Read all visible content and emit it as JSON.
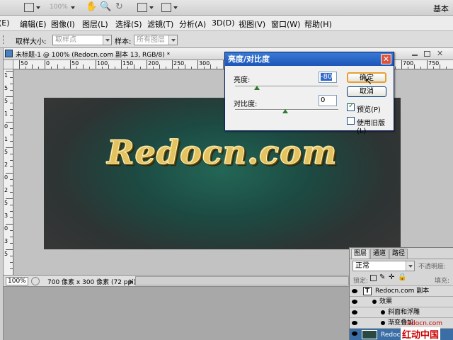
{
  "appbar": {
    "zoom": "100%",
    "workspace": "基本"
  },
  "menu": {
    "items": [
      "编辑(E)",
      "图像(I)",
      "图层(L)",
      "选择(S)",
      "滤镜(T)",
      "分析(A)",
      "3D(D)",
      "视图(V)",
      "窗口(W)",
      "帮助(H)"
    ],
    "left_fragment": "(E)"
  },
  "options": {
    "sample_size_label": "取样大小:",
    "sample_size_value": "取样点",
    "sample_label": "样本:",
    "sample_value": "所有图层"
  },
  "document": {
    "tab_title": "未标题-1 @ 100% (Redocn.com 副本 13, RGB/8) *",
    "ruler_top": [
      "50",
      "0",
      "50",
      "100",
      "150",
      "200",
      "250",
      "300",
      "350",
      "400",
      "450",
      "500",
      "550",
      "600",
      "650",
      "700",
      "750"
    ],
    "ruler_left": [
      "1",
      "5",
      "5",
      "1",
      "0",
      "1",
      "5",
      "2",
      "0",
      "2",
      "5",
      "3",
      "0",
      "3",
      "5"
    ],
    "artwork_text": "Redocn.com",
    "status_zoom": "100%",
    "status_info": "700 像素 x 300 像素 (72 ppi)"
  },
  "dialog": {
    "title": "亮度/对比度",
    "brightness_label": "亮度:",
    "brightness_value": "-80",
    "contrast_label": "对比度:",
    "contrast_value": "0",
    "ok_label": "确定",
    "cancel_label": "取消",
    "preview_label": "预览(P)",
    "preview_checked": true,
    "legacy_label": "使用旧版(L)",
    "legacy_checked": false
  },
  "layers": {
    "tabs": [
      "图层",
      "通道",
      "路径"
    ],
    "blend_mode": "正常",
    "opacity_label": "不透明度:",
    "lock_label": "锁定:",
    "fill_label": "填充:",
    "rows": [
      {
        "name": "Redocn.com 副本",
        "kind": "text"
      },
      {
        "name": "效果",
        "kind": "effects"
      },
      {
        "name": "斜面和浮雕",
        "kind": "effect"
      },
      {
        "name": "渐变叠加",
        "kind": "effect"
      },
      {
        "name": "Redocn.co",
        "kind": "thumb"
      }
    ]
  },
  "watermark": {
    "url": "redocn.com",
    "text": "红动中国"
  },
  "colors": {
    "accent": "#1b55b8",
    "gold": "#e4c35e",
    "teal": "#236656"
  }
}
